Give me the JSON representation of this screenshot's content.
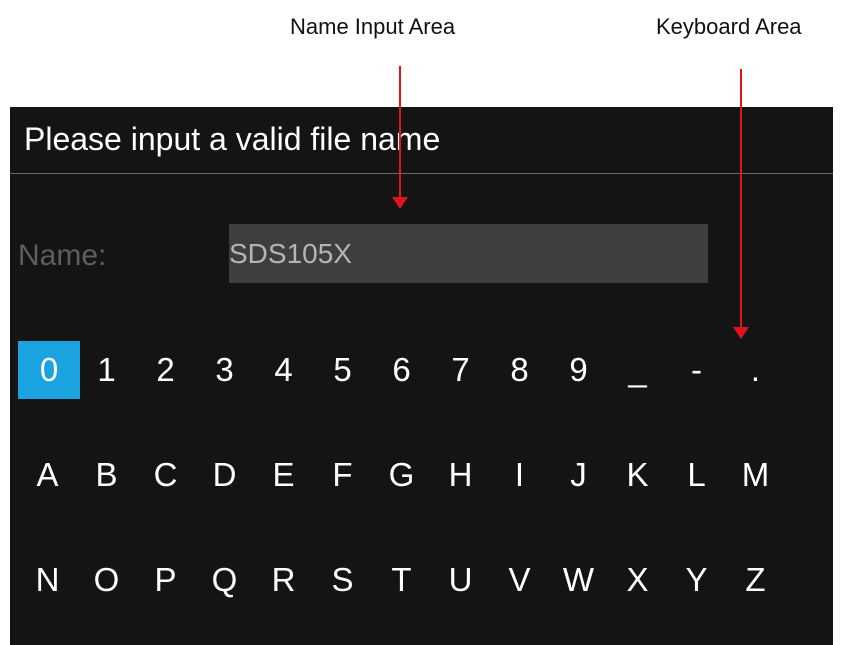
{
  "callouts": {
    "name_input_area": "Name Input Area",
    "keyboard_area": "Keyboard Area"
  },
  "dialog": {
    "title": "Please input a valid file name",
    "name_label": "Name:",
    "name_value": "SDS105X"
  },
  "keyboard": {
    "selected_key": "0",
    "rows": [
      [
        "0",
        "1",
        "2",
        "3",
        "4",
        "5",
        "6",
        "7",
        "8",
        "9",
        "_",
        "-",
        "."
      ],
      [
        "A",
        "B",
        "C",
        "D",
        "E",
        "F",
        "G",
        "H",
        "I",
        "J",
        "K",
        "L",
        "M"
      ],
      [
        "N",
        "O",
        "P",
        "Q",
        "R",
        "S",
        "T",
        "U",
        "V",
        "W",
        "X",
        "Y",
        "Z"
      ]
    ]
  },
  "colors": {
    "dialog_background": "#141414",
    "input_background": "#3e3e3e",
    "selected_key": "#1aa3e0",
    "annotation_arrow": "#e0141b"
  }
}
